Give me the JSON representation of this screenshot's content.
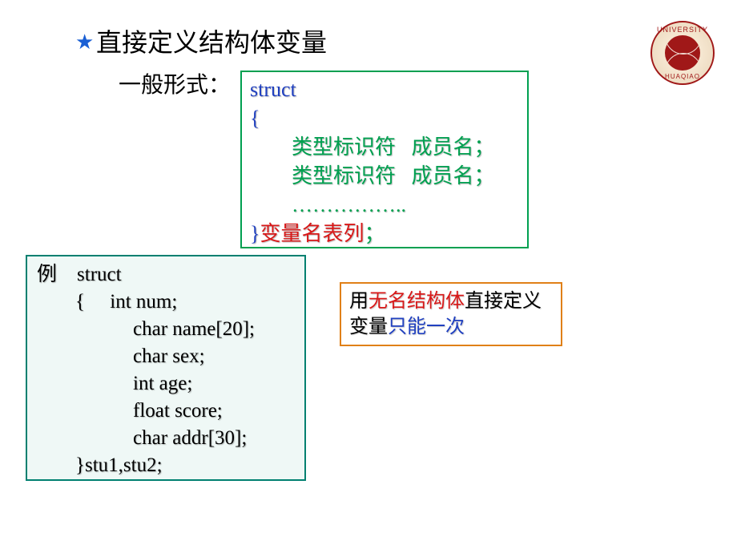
{
  "title": "直接定义结构体变量",
  "subtitle": "一般形式：",
  "logo": {
    "top_text": "UNIVERSITY",
    "bottom_text": "HUAQIAO"
  },
  "syntax": {
    "kw_struct": "struct",
    "brace_open": "{",
    "type_id": "类型标识符",
    "member_name": "成员名；",
    "ellipsis": "……………..",
    "brace_close": "}",
    "var_list": "变量名表列",
    "semicolon": "；"
  },
  "example": {
    "label": "例",
    "kw_struct": "struct",
    "brace_open": "{",
    "l1": "int num;",
    "l2": "char  name[20];",
    "l3": "char sex;",
    "l4": "int age;",
    "l5": "float score;",
    "l6": "char addr[30];",
    "brace_close_line": "}stu1,stu2;"
  },
  "callout": {
    "pre": "用",
    "red": "无名结构体",
    "mid": "直接定义变量",
    "blue": "只能一次"
  }
}
